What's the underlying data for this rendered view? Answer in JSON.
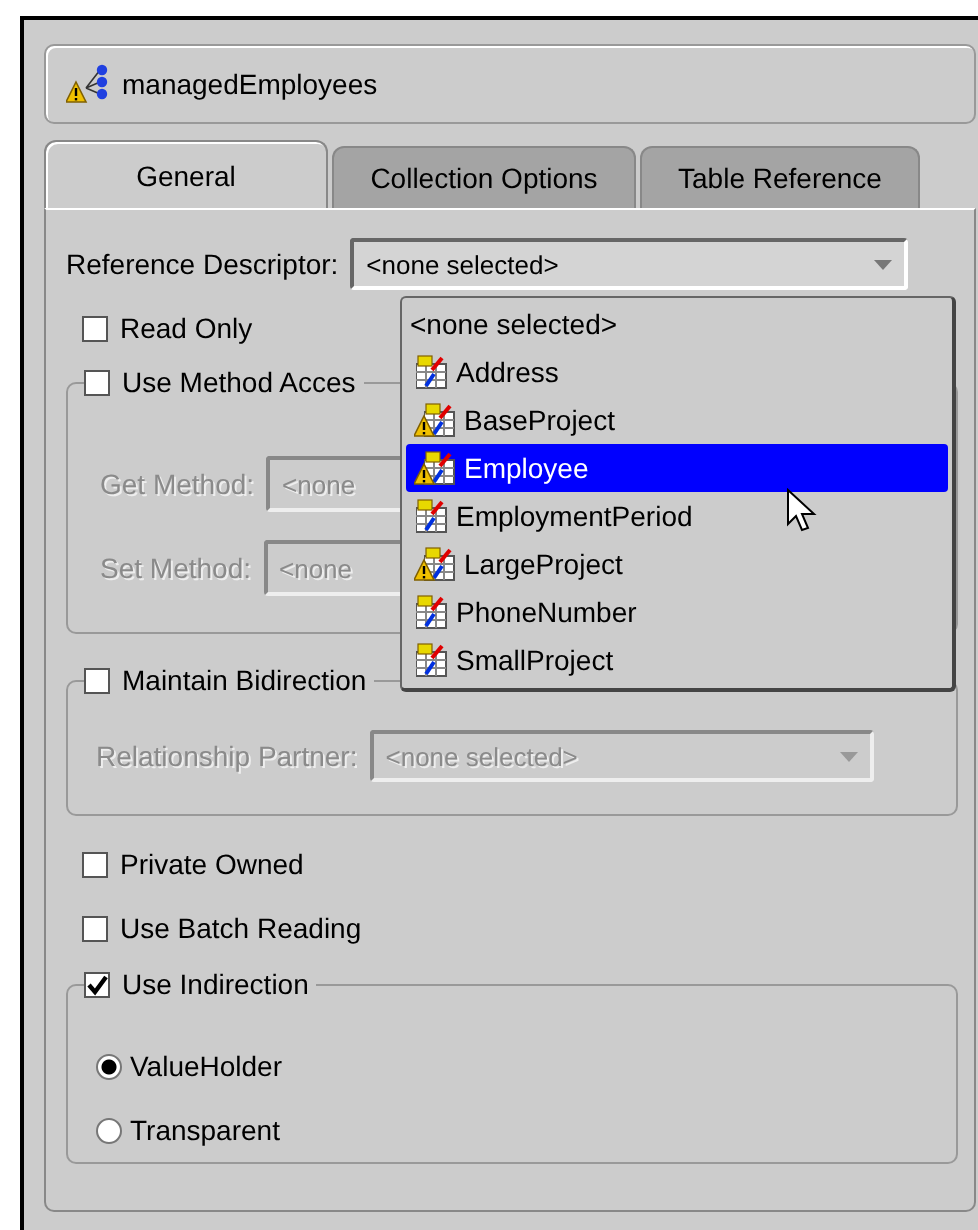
{
  "header": {
    "title": "managedEmployees",
    "warning": true
  },
  "tabs": [
    {
      "label": "General",
      "selected": true
    },
    {
      "label": "Collection Options",
      "selected": false
    },
    {
      "label": "Table Reference",
      "selected": false
    }
  ],
  "reference_descriptor": {
    "label": "Reference Descriptor:",
    "value": "<none selected>",
    "expanded": true
  },
  "dropdown_items": [
    {
      "label": "<none selected>",
      "kind": "none",
      "selected": false
    },
    {
      "label": "Address",
      "kind": "descriptor",
      "warning": false,
      "selected": false
    },
    {
      "label": "BaseProject",
      "kind": "descriptor",
      "warning": true,
      "selected": false
    },
    {
      "label": "Employee",
      "kind": "descriptor",
      "warning": true,
      "selected": true
    },
    {
      "label": "EmploymentPeriod",
      "kind": "descriptor",
      "warning": false,
      "selected": false
    },
    {
      "label": "LargeProject",
      "kind": "descriptor",
      "warning": true,
      "selected": false
    },
    {
      "label": "PhoneNumber",
      "kind": "descriptor",
      "warning": false,
      "selected": false
    },
    {
      "label": "SmallProject",
      "kind": "descriptor",
      "warning": false,
      "selected": false
    }
  ],
  "read_only": {
    "label": "Read Only",
    "checked": false
  },
  "method_accessing": {
    "label": "Use Method Acces",
    "checked": false,
    "disabled": true,
    "get_label": "Get Method:",
    "get_value": "<none",
    "set_label": "Set Method:",
    "set_value": "<none"
  },
  "bidirectional": {
    "label": "Maintain Bidirection",
    "checked": false,
    "disabled": true,
    "partner_label": "Relationship Partner:",
    "partner_value": "<none selected>"
  },
  "private_owned": {
    "label": "Private Owned",
    "checked": false
  },
  "batch_reading": {
    "label": "Use Batch Reading",
    "checked": false
  },
  "indirection": {
    "label": "Use Indirection",
    "checked": true,
    "options": [
      {
        "label": "ValueHolder",
        "selected": true
      },
      {
        "label": "Transparent",
        "selected": false
      }
    ]
  }
}
